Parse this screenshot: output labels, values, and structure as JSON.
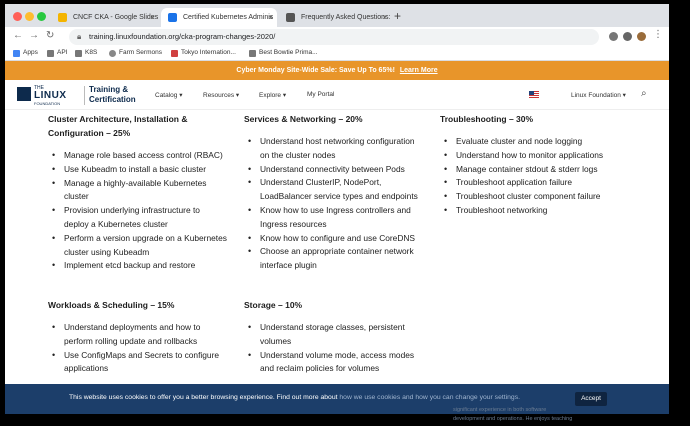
{
  "browser": {
    "tabs": [
      {
        "title": "CNCF CKA - Google Slides",
        "active": false,
        "favicon_color": "#f4b400"
      },
      {
        "title": "Certified Kubernetes Adminis",
        "active": true,
        "favicon_color": "#1a73e8"
      },
      {
        "title": "Frequently Asked Questions:",
        "active": false,
        "favicon_color": "#555555"
      }
    ],
    "new_tab": "+",
    "close": "×",
    "url": "training.linuxfoundation.org/cka-program-changes-2020/",
    "bookmarks": [
      {
        "label": "Apps",
        "color": "#4285f4"
      },
      {
        "label": "API",
        "color": "#777777"
      },
      {
        "label": "K8S",
        "color": "#777777"
      },
      {
        "label": "Farm Sermons",
        "color": "#888888"
      },
      {
        "label": "Tokyo Internation...",
        "color": "#d04040"
      },
      {
        "label": "Best Bowtie Prima...",
        "color": "#777777"
      }
    ]
  },
  "promo": {
    "text": "Cyber Monday Site-Wide Sale: Save Up To 65%!",
    "link": "Learn More"
  },
  "site": {
    "logo_the": "THE",
    "logo_linux": "LINUX",
    "logo_foundation": "FOUNDATION",
    "brand_line1": "Training &",
    "brand_line2": "Certification",
    "nav": [
      "Catalog ▾",
      "Resources ▾",
      "Explore ▾",
      "My Portal"
    ],
    "right_nav": "Linux Foundation ▾"
  },
  "domains": {
    "cluster": {
      "title1": "Cluster Architecture, Installation &",
      "title2": "Configuration – 25%",
      "items": [
        "Manage role based access control (RBAC)",
        "Use Kubeadm to install a basic cluster",
        "Manage a highly-available Kubernetes",
        "cluster",
        "Provision underlying infrastructure to",
        "deploy a Kubernetes cluster",
        "Perform a version upgrade on a Kubernetes",
        "cluster using Kubeadm",
        "Implement etcd backup and restore"
      ]
    },
    "services": {
      "title1": "Services & Networking – 20%",
      "items": [
        "Understand host networking configuration",
        "on the cluster nodes",
        "Understand connectivity between Pods",
        "Understand ClusterIP, NodePort,",
        "LoadBalancer service types and endpoints",
        "Know how to use Ingress controllers and",
        "Ingress resources",
        "Know how to configure and use CoreDNS",
        "Choose an appropriate container network",
        "interface plugin"
      ]
    },
    "troubleshooting": {
      "title1": "Troubleshooting – 30%",
      "items": [
        "Evaluate cluster and node logging",
        "Understand how to monitor applications",
        "Manage container stdout & stderr logs",
        "Troubleshoot application failure",
        "Troubleshoot cluster component failure",
        "Troubleshoot networking"
      ]
    },
    "workloads": {
      "title1": "Workloads & Scheduling – 15%",
      "items": [
        "Understand deployments and how to",
        "perform rolling update and rollbacks",
        "Use ConfigMaps and Secrets to configure",
        "applications"
      ]
    },
    "storage": {
      "title1": "Storage – 10%",
      "items": [
        "Understand storage classes, persistent",
        "volumes",
        "Understand volume mode, access modes",
        "and reclaim policies for volumes"
      ]
    }
  },
  "cookie": {
    "message": "This website uses cookies to offer you a better browsing experience. Find out more about",
    "dim": "how we use cookies and how you can change your settings.",
    "accept": "Accept",
    "behind_1": "significant experience in both software",
    "behind_2": "development and operations. He enjoys teaching"
  }
}
